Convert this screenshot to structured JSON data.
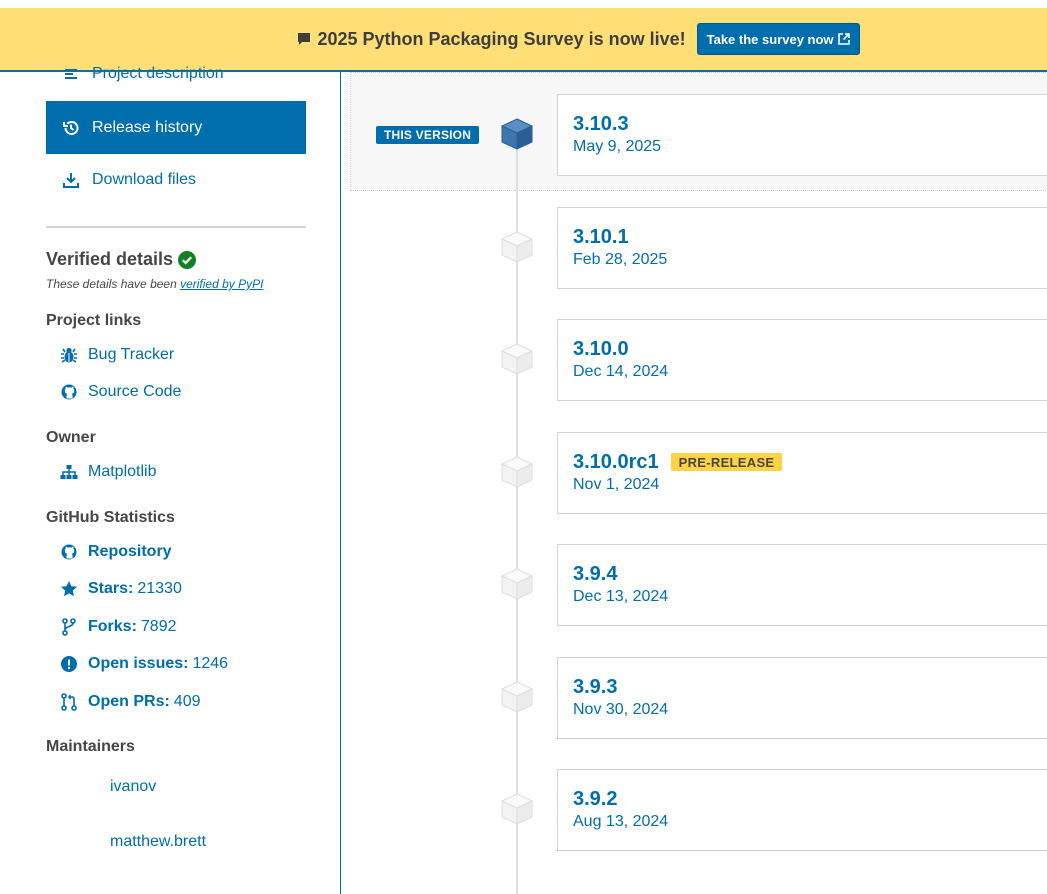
{
  "banner": {
    "text": "2025 Python Packaging Survey is now live!",
    "button_label": "Take the survey now"
  },
  "nav": {
    "items": [
      {
        "label": "Project description",
        "icon": "align-left-icon"
      },
      {
        "label": "Release history",
        "icon": "history-icon",
        "active": true
      },
      {
        "label": "Download files",
        "icon": "download-icon"
      }
    ]
  },
  "verified": {
    "title": "Verified details",
    "note_prefix": "These details have been ",
    "note_link": "verified by PyPI"
  },
  "project_links": {
    "title": "Project links",
    "items": [
      {
        "label": "Bug Tracker",
        "icon": "bug-icon"
      },
      {
        "label": "Source Code",
        "icon": "github-icon"
      }
    ]
  },
  "owner": {
    "title": "Owner",
    "name": "Matplotlib"
  },
  "github": {
    "title": "GitHub Statistics",
    "repository": "Repository",
    "stars_label": "Stars:",
    "stars": "21330",
    "forks_label": "Forks:",
    "forks": "7892",
    "issues_label": "Open issues:",
    "issues": "1246",
    "prs_label": "Open PRs:",
    "prs": "409"
  },
  "maintainers": {
    "title": "Maintainers",
    "names": [
      "ivanov",
      "matthew.brett"
    ]
  },
  "this_version_badge": "THIS VERSION",
  "prerelease_badge": "PRE-RELEASE",
  "releases": [
    {
      "version": "3.10.3",
      "date": "May 9, 2025",
      "current": true
    },
    {
      "version": "3.10.1",
      "date": "Feb 28, 2025"
    },
    {
      "version": "3.10.0",
      "date": "Dec 14, 2024"
    },
    {
      "version": "3.10.0rc1",
      "date": "Nov 1, 2024",
      "prerelease": true
    },
    {
      "version": "3.9.4",
      "date": "Dec 13, 2024"
    },
    {
      "version": "3.9.3",
      "date": "Nov 30, 2024"
    },
    {
      "version": "3.9.2",
      "date": "Aug 13, 2024"
    }
  ],
  "colors": {
    "accent": "#006dad",
    "banner": "#ffdf76",
    "prerelease": "#ffd343",
    "verified": "#148024"
  }
}
